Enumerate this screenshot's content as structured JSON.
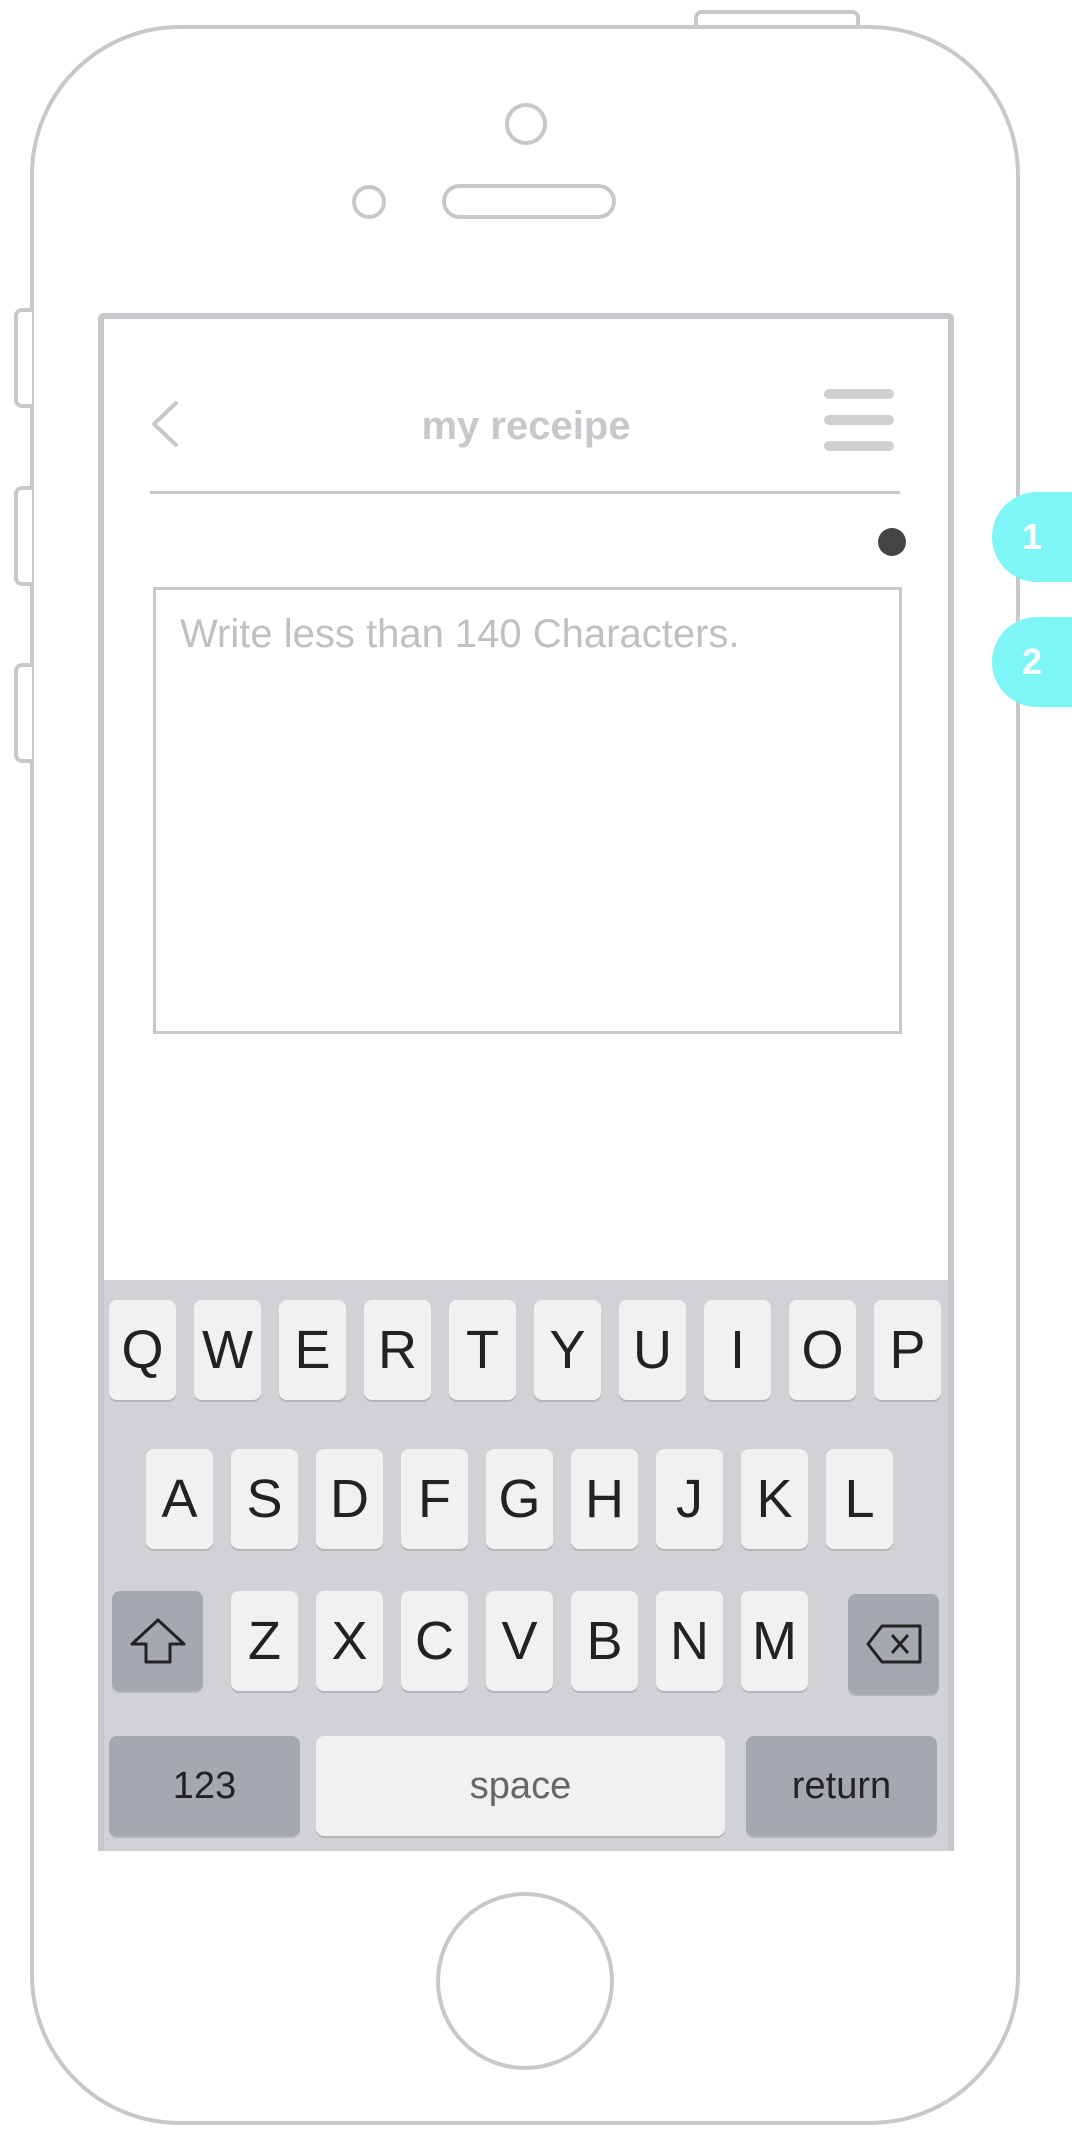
{
  "header": {
    "title": "my receipe",
    "back_icon": "chevron-left-icon",
    "menu_icon": "hamburger-menu-icon"
  },
  "composer": {
    "placeholder": "Write less than 140 Characters.",
    "value": ""
  },
  "keyboard": {
    "row1": [
      "Q",
      "W",
      "E",
      "R",
      "T",
      "Y",
      "U",
      "I",
      "O",
      "P"
    ],
    "row2": [
      "A",
      "S",
      "D",
      "F",
      "G",
      "H",
      "J",
      "K",
      "L"
    ],
    "row3": [
      "Z",
      "X",
      "C",
      "V",
      "B",
      "N",
      "M"
    ],
    "shift_icon": "shift-arrow-icon",
    "delete_icon": "backspace-icon",
    "numbers_label": "123",
    "space_label": "space",
    "return_label": "return"
  },
  "annotations": {
    "badge1": "1",
    "badge2": "2",
    "badge_color": "#7ef6f8"
  },
  "colors": {
    "frame": "#c8c8cc",
    "keyboard_bg": "#d1d2d6",
    "key_light": "#f1f1f1",
    "key_dark": "#a5a8ae",
    "status_dot": "#444444"
  }
}
